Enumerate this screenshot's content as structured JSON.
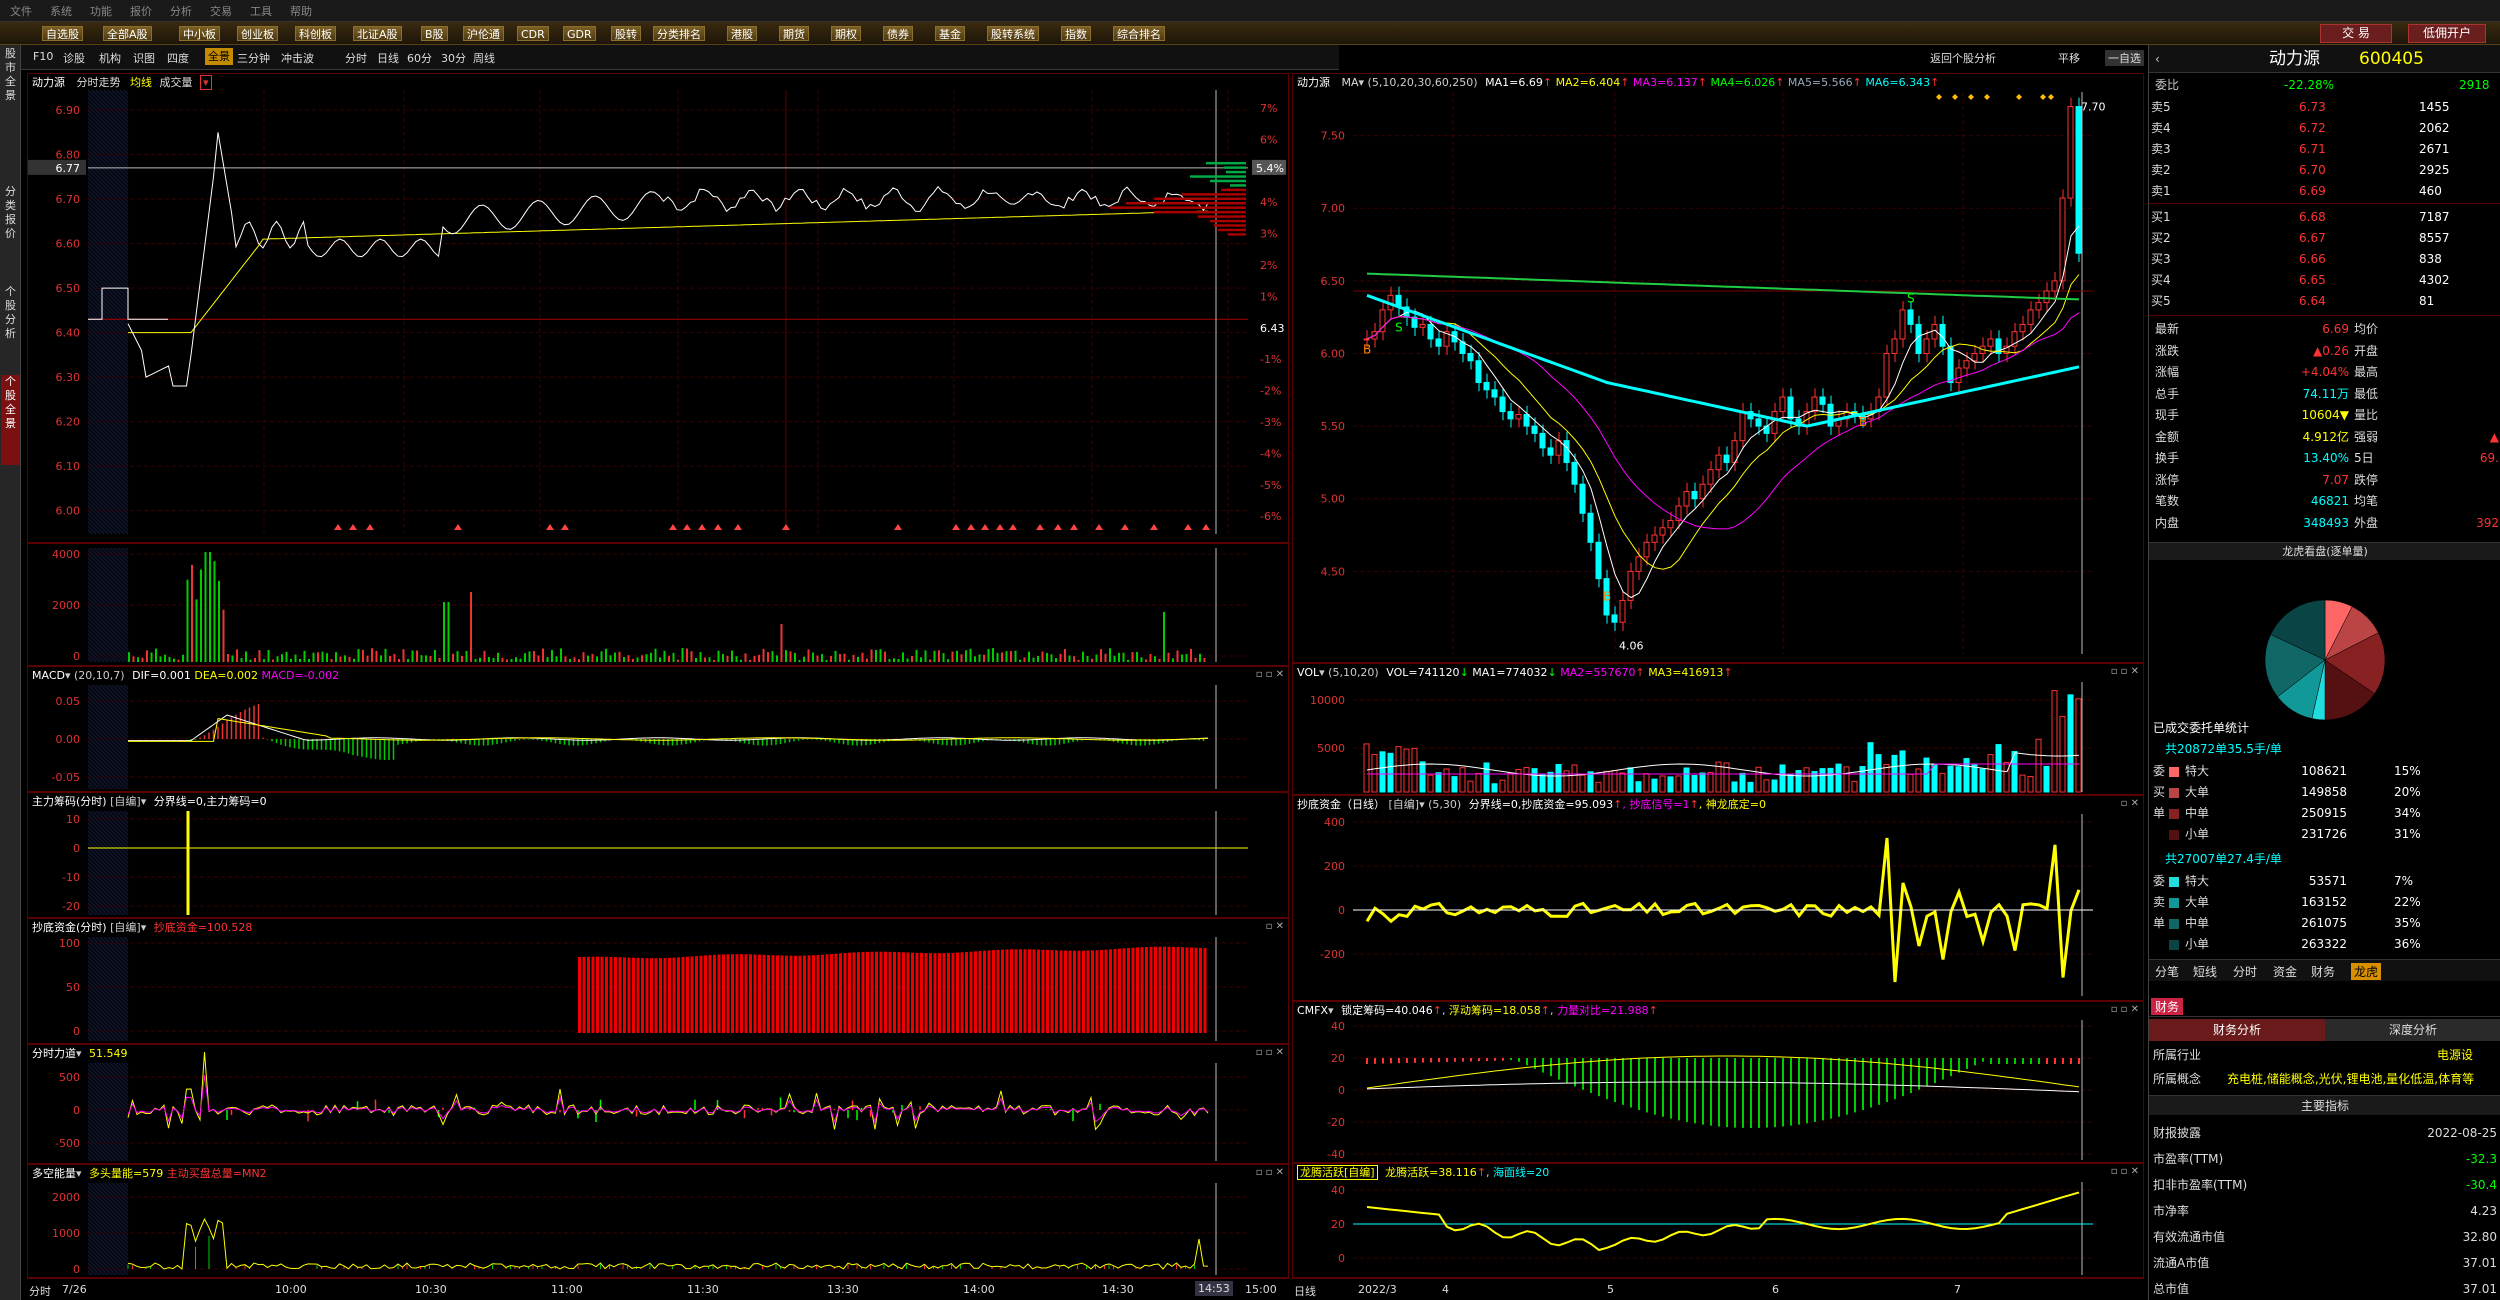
{
  "topbar": {
    "items": [
      "文件",
      "系统",
      "功能",
      "报价",
      "分析",
      "交易",
      "工具",
      "帮助"
    ]
  },
  "menubar": {
    "items": [
      "自选股",
      "全部A股",
      "中小板",
      "创业板",
      "科创板",
      "北证A股",
      "B股",
      "沪伦通",
      "CDR",
      "GDR",
      "股转",
      "分类排名",
      "港股",
      "期货",
      "期权",
      "债券",
      "基金",
      "股转系统",
      "指数",
      "综合排名"
    ],
    "trade_button": "交 易",
    "open_account_button": "低佣开户"
  },
  "left_tabs": [
    {
      "label": "股市全景"
    },
    {
      "label": "分类报价"
    },
    {
      "label": "个股分析"
    },
    {
      "label": "个股全景"
    }
  ],
  "subtool": {
    "items": [
      "F10",
      "诊股",
      "机构",
      "识图",
      "四度",
      "全景",
      "三分钟",
      "冲击波",
      "分时",
      "日线",
      "60分",
      "30分",
      "周线"
    ],
    "active": "全景",
    "right_items": [
      "返回个股分析",
      "平移",
      "一自选"
    ]
  },
  "intraday": {
    "header_title": "动力源",
    "header_mode": "分时走势",
    "header_avg": "均线",
    "header_vol": "成交量",
    "price_ticks": [
      "6.90",
      "6.80",
      "6.70",
      "6.60",
      "6.50",
      "6.40",
      "6.30",
      "6.20",
      "6.10",
      "6.00"
    ],
    "pct_ticks": [
      "7%",
      "6%",
      "5%",
      "4%",
      "3%",
      "2%",
      "1%",
      "6.43",
      "-1%",
      "-2%",
      "-3%",
      "-4%",
      "-5%",
      "-6%"
    ],
    "cursor_price": "6.77",
    "cursor_pct": "5.4%",
    "vol_ticks": [
      "4000",
      "2000",
      "0"
    ],
    "time_labels": [
      "7/26",
      "10:00",
      "10:30",
      "11:00",
      "11:30",
      "13:30",
      "14:00",
      "14:30",
      "14:53",
      "15:00"
    ],
    "axis_left": "分时"
  },
  "macd_intra": {
    "name": "MACD",
    "params": "(20,10,7)",
    "dif": "DIF=0.001",
    "dea": "DEA=0.002",
    "macd": "MACD=-0.002",
    "ticks": [
      "0.05",
      "0.00",
      "-0.05"
    ]
  },
  "zljm": {
    "name": "主力筹码(分时)",
    "tag": "[自编]",
    "line": "分界线=0,主力筹码=0",
    "ticks": [
      "10",
      "0",
      "-10",
      "-20"
    ]
  },
  "cdzj": {
    "name": "抄底资金(分时)",
    "tag": "[自编]",
    "value": "抄底资金=100.528",
    "ticks": [
      "100",
      "50",
      "0"
    ]
  },
  "fsld": {
    "name": "分时力道",
    "value": "51.549",
    "ticks": [
      "500",
      "0",
      "-500"
    ]
  },
  "dknl": {
    "name": "多空能量",
    "value": "多头量能=579",
    "value2": "主动买盘总量=MN2",
    "ticks": [
      "2000",
      "1000",
      "0"
    ]
  },
  "kline": {
    "header_title": "动力源",
    "ma_label": "MA",
    "ma_params": "(5,10,20,30,60,250)",
    "ma1": "MA1=6.69",
    "ma2": "MA2=6.404",
    "ma3": "MA3=6.137",
    "ma4": "MA4=6.026",
    "ma5": "MA5=5.566",
    "ma6": "MA6=6.343",
    "price_ticks": [
      "7.50",
      "7.00",
      "6.50",
      "6.00",
      "5.50",
      "5.00",
      "4.50"
    ],
    "high_label": "7.70",
    "low_label": "4.06",
    "date_labels": [
      "2022/3",
      "4",
      "5",
      "6",
      "7"
    ],
    "axis_left": "日线"
  },
  "vol_daily": {
    "name": "VOL",
    "params": "(5,10,20)",
    "vol": "VOL=741120",
    "ma1": "MA1=774032",
    "ma2": "MA2=557670",
    "ma3": "MA3=416913",
    "ticks": [
      "10000",
      "5000"
    ]
  },
  "cdzj_daily": {
    "name": "抄底资金（日线）",
    "tag": "[自编]",
    "params": "(5,30)",
    "line": "分界线=0,抄底资金=95.093",
    "extra": "抄底信号=1",
    "extra2": "神龙底定=0",
    "ticks": [
      "400",
      "200",
      "0",
      "-200"
    ]
  },
  "cmfx": {
    "name": "CMFX",
    "v1": "锁定筹码=40.046",
    "v2": "浮动筹码=18.058",
    "v3": "力量对比=21.988",
    "ticks": [
      "40",
      "20",
      "0",
      "-20",
      "-40"
    ]
  },
  "lths": {
    "name": "龙腾活跃[自编]",
    "v1": "龙腾活跃=38.116",
    "v2": "海面线=20",
    "ticks": [
      "40",
      "20",
      "0"
    ]
  },
  "quote": {
    "name": "动力源",
    "code": "600405",
    "webi_label": "委比",
    "webi_pct": "-22.28%",
    "webi_num": "2918",
    "sell": [
      [
        "卖5",
        "6.73",
        "1455"
      ],
      [
        "卖4",
        "6.72",
        "2062"
      ],
      [
        "卖3",
        "6.71",
        "2671"
      ],
      [
        "卖2",
        "6.70",
        "2925"
      ],
      [
        "卖1",
        "6.69",
        "460"
      ]
    ],
    "buy": [
      [
        "买1",
        "6.68",
        "7187"
      ],
      [
        "买2",
        "6.67",
        "8557"
      ],
      [
        "买3",
        "6.66",
        "838"
      ],
      [
        "买4",
        "6.65",
        "4302"
      ],
      [
        "买5",
        "6.64",
        "81"
      ]
    ],
    "stats": [
      [
        "最新",
        "6.69",
        "均价",
        ""
      ],
      [
        "涨跌",
        "▲0.26",
        "开盘",
        ""
      ],
      [
        "涨幅",
        "+4.04%",
        "最高",
        ""
      ],
      [
        "总手",
        "74.11万",
        "最低",
        ""
      ],
      [
        "现手",
        "10604▼",
        "量比",
        ""
      ],
      [
        "金额",
        "4.912亿",
        "强弱",
        "▲"
      ],
      [
        "换手",
        "13.40%",
        "5日",
        "69."
      ],
      [
        "涨停",
        "7.07",
        "跌停",
        ""
      ],
      [
        "笔数",
        "46821",
        "均笔",
        ""
      ],
      [
        "内盘",
        "348493",
        "外盘",
        "392"
      ]
    ],
    "lh_title": "龙虎看盘(逐单量)",
    "done_title": "已成交委托单统计",
    "sum1": "共20872单35.5手/单",
    "rows1": [
      [
        "委",
        "特大",
        "108621",
        "15%"
      ],
      [
        "买",
        "大单",
        "149858",
        "20%"
      ],
      [
        "单",
        "中单",
        "250915",
        "34%"
      ],
      [
        "",
        "小单",
        "231726",
        "31%"
      ]
    ],
    "sum2": "共27007单27.4手/单",
    "rows2": [
      [
        "委",
        "特大",
        "53571",
        "7%"
      ],
      [
        "卖",
        "大单",
        "163152",
        "22%"
      ],
      [
        "单",
        "中单",
        "261075",
        "35%"
      ],
      [
        "",
        "小单",
        "263322",
        "36%"
      ]
    ],
    "tabs": [
      "分笔",
      "短线",
      "分时",
      "资金",
      "财务",
      "龙虎"
    ],
    "tab_active": "龙虎",
    "fin_tab": "财务",
    "fin_sub": [
      "财务分析",
      "深度分析"
    ],
    "industry_label": "所属行业",
    "industry": "电源设",
    "concept_label": "所属概念",
    "concept": "充电桩,储能概念,光伏,锂电池,量化低温,体育等",
    "key_title": "主要指标",
    "fin": [
      [
        "财报披露",
        "2022-08-25"
      ],
      [
        "市盈率(TTM)",
        "-32.3"
      ],
      [
        "扣非市盈率(TTM)",
        "-30.4"
      ],
      [
        "市净率",
        "4.23"
      ],
      [
        "有效流通市值",
        "32.80"
      ],
      [
        "流通A市值",
        "37.01"
      ],
      [
        "总市值",
        "37.01"
      ]
    ]
  }
}
